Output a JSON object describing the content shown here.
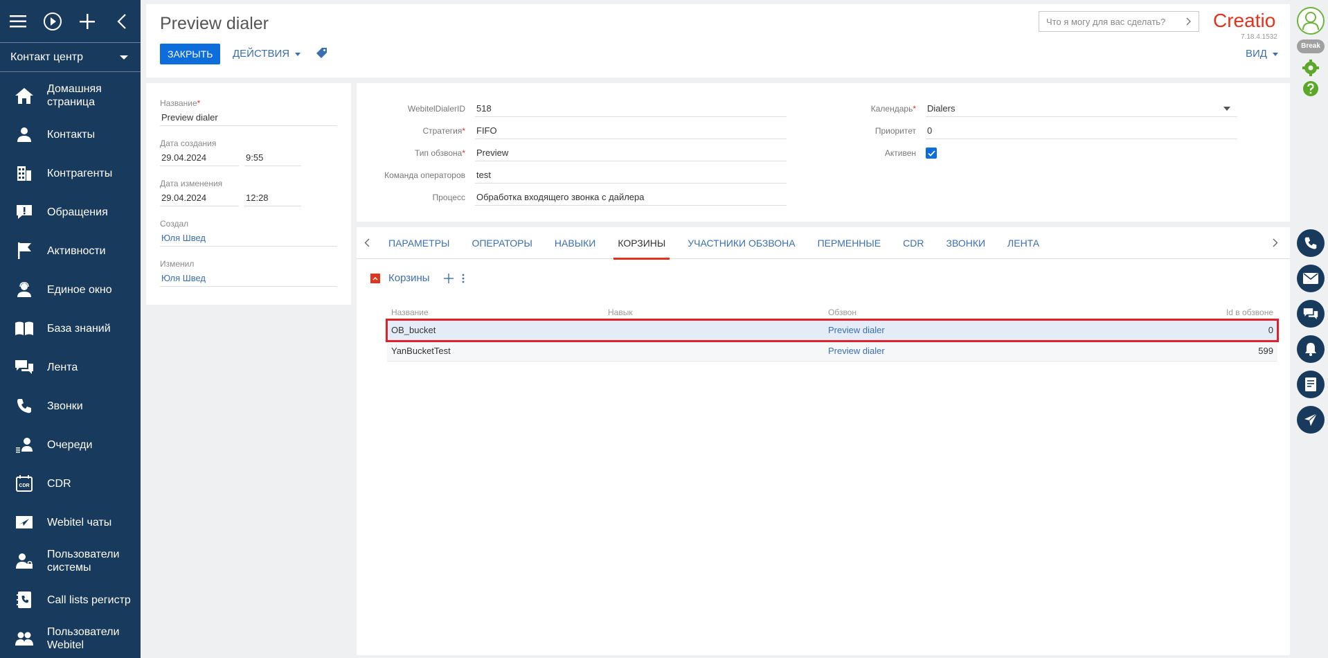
{
  "sidebar": {
    "section": "Контакт центр",
    "items": [
      {
        "label": "Домашняя страница",
        "icon": "home-icon"
      },
      {
        "label": "Контакты",
        "icon": "person-icon"
      },
      {
        "label": "Контрагенты",
        "icon": "building-icon"
      },
      {
        "label": "Обращения",
        "icon": "alert-icon"
      },
      {
        "label": "Активности",
        "icon": "flag-icon"
      },
      {
        "label": "Единое окно",
        "icon": "agent-icon"
      },
      {
        "label": "База знаний",
        "icon": "book-icon"
      },
      {
        "label": "Лента",
        "icon": "chat-icon"
      },
      {
        "label": "Звонки",
        "icon": "phone-icon"
      },
      {
        "label": "Очереди",
        "icon": "queue-icon"
      },
      {
        "label": "CDR",
        "icon": "cdr-icon"
      },
      {
        "label": "Webitel чаты",
        "icon": "send-icon"
      },
      {
        "label": "Пользователи системы",
        "icon": "user-lock-icon"
      },
      {
        "label": "Call lists регистр",
        "icon": "contact-book-icon"
      },
      {
        "label": "Пользователи Webitel",
        "icon": "users-icon"
      }
    ]
  },
  "header": {
    "title": "Preview dialer",
    "close_label": "ЗАКРЫТЬ",
    "actions_label": "ДЕЙСТВИЯ",
    "search_placeholder": "Что я могу для вас сделать?",
    "logo": "Creatio",
    "version": "7.18.4.1532",
    "view_label": "ВИД"
  },
  "info": {
    "name_label": "Название",
    "name_value": "Preview dialer",
    "created_label": "Дата создания",
    "created_date": "29.04.2024",
    "created_time": "9:55",
    "modified_label": "Дата изменения",
    "modified_date": "29.04.2024",
    "modified_time": "12:28",
    "author_label": "Создал",
    "author_value": "Юля Швед",
    "editor_label": "Изменил",
    "editor_value": "Юля Швед"
  },
  "details": {
    "dialer_id_label": "WebitelDialerID",
    "dialer_id_value": "518",
    "strategy_label": "Стратегия",
    "strategy_value": "FIFO",
    "type_label": "Тип обзвона",
    "type_value": "Preview",
    "team_label": "Команда операторов",
    "team_value": "test",
    "process_label": "Процесс",
    "process_value": "Обработка входящего звонка с дайлера",
    "calendar_label": "Календарь",
    "calendar_value": "Dialers",
    "priority_label": "Приоритет",
    "priority_value": "0",
    "active_label": "Активен",
    "active_checked": true
  },
  "tabs": [
    "ПАРАМЕТРЫ",
    "ОПЕРАТОРЫ",
    "НАВЫКИ",
    "КОРЗИНЫ",
    "УЧАСТНИКИ ОБЗВОНА",
    "ПЕРМЕННЫЕ",
    "CDR",
    "ЗВОНКИ",
    "ЛЕНТА"
  ],
  "active_tab": "КОРЗИНЫ",
  "buckets": {
    "title": "Корзины",
    "columns": [
      "Название",
      "Навык",
      "Обзвон",
      "Id в обзвоне"
    ],
    "rows": [
      {
        "name": "OB_bucket",
        "skill": "",
        "dialer": "Preview dialer",
        "id": "0"
      },
      {
        "name": "YanBucketTest",
        "skill": "",
        "dialer": "Preview dialer",
        "id": "599"
      }
    ]
  },
  "rightbar": {
    "status": "Break"
  },
  "colors": {
    "sidebar_bg": "#183a5c",
    "accent": "#0d6ddb",
    "brand": "#e0341f",
    "link": "#3a6fb0"
  }
}
